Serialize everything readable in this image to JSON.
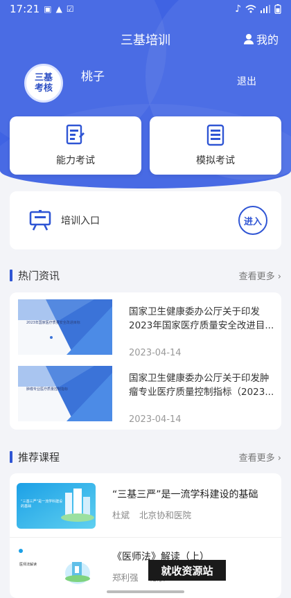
{
  "status_bar": {
    "time": "17:21"
  },
  "header": {
    "title": "三基培训",
    "mine_label": "我的"
  },
  "user": {
    "avatar_text": "三基考核",
    "name": "桃子",
    "logout_label": "退出"
  },
  "exams": [
    {
      "label": "能力考试",
      "icon": "exam-doc-icon"
    },
    {
      "label": "模拟考试",
      "icon": "list-doc-icon"
    }
  ],
  "training": {
    "label": "培训入口",
    "enter_label": "进入",
    "icon": "presentation-board-icon"
  },
  "news": {
    "section_title": "热门资讯",
    "more_label": "查看更多",
    "items": [
      {
        "title": "国家卫生健康委办公厅关于印发2023年国家医疗质量安全改进目...",
        "date": "2023-04-14",
        "thumb_text": "2023年国家医疗质量安全改进目标"
      },
      {
        "title": "国家卫生健康委办公厅关于印发肿瘤专业医疗质量控制指标（2023...",
        "date": "2023-04-14",
        "thumb_text": "肿瘤专业医疗质量控制指标"
      }
    ]
  },
  "courses": {
    "section_title": "推荐课程",
    "more_label": "查看更多",
    "items": [
      {
        "title": "“三基三严”是一流学科建设的基础",
        "teacher": "杜斌",
        "org": "北京协和医院",
        "thumb_text": "“三基三严”是一流学科建设的基础"
      },
      {
        "title": "《医师法》解读（上）",
        "teacher": "郑利强",
        "org": "北京",
        "thumb_text": "医师法解读"
      }
    ]
  },
  "watermark": "就收资源站",
  "colors": {
    "primary": "#3f63e3",
    "accent": "#2f55d4"
  }
}
